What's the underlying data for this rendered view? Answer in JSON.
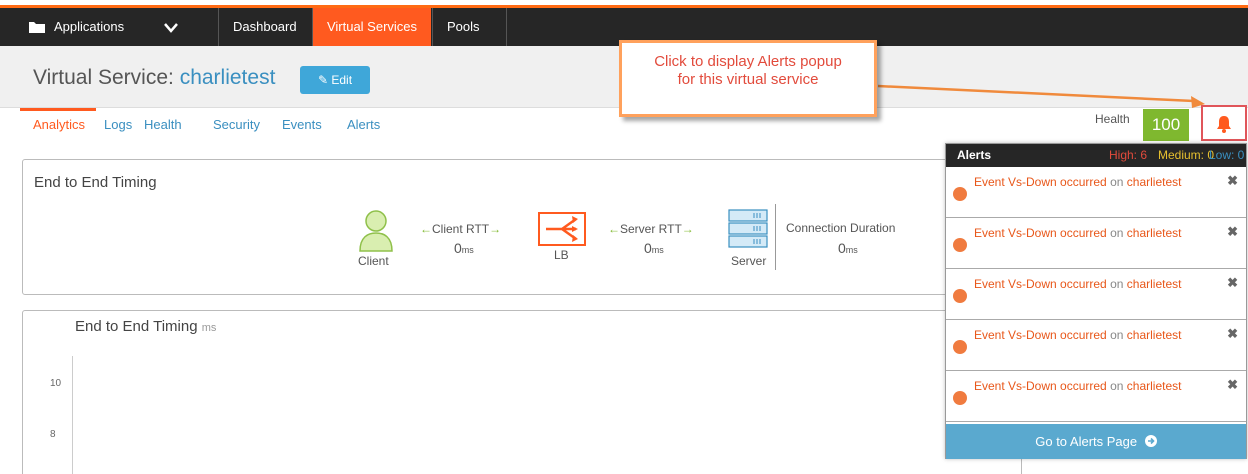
{
  "nav": {
    "applications_label": "Applications",
    "items": [
      "Dashboard",
      "Virtual Services",
      "Pools"
    ],
    "active_index": 1,
    "accent_color": "#ff5a1f"
  },
  "header": {
    "title_prefix": "Virtual Service:",
    "vs_name": "charlietest",
    "edit_label": "Edit"
  },
  "tabs": [
    "Analytics",
    "Logs",
    "Health",
    "Security",
    "Events",
    "Alerts"
  ],
  "health": {
    "label": "Health",
    "score": "100",
    "color": "#7fb82f"
  },
  "callout": {
    "line1": "Click to display Alerts popup",
    "line2": "for this virtual service"
  },
  "timing_panel": {
    "title": "End to End Timing",
    "client_label": "Client",
    "lb_label": "LB",
    "server_label": "Server",
    "client_rtt_label": "Client RTT",
    "server_rtt_label": "Server RTT",
    "connection_duration_label": "Connection Duration",
    "client_rtt_value": "0",
    "server_rtt_value": "0",
    "connection_duration_value": "0",
    "unit": "ms"
  },
  "chart_panel": {
    "title": "End to End Timing",
    "unit": "ms",
    "y_ticks": [
      "10",
      "8"
    ]
  },
  "alerts_popup": {
    "title": "Alerts",
    "high": "High: 6",
    "medium": "Medium: 0",
    "low": "Low: 0",
    "items": [
      {
        "event": "Event Vs-Down occurred",
        "on": "on",
        "object": "charlietest"
      },
      {
        "event": "Event Vs-Down occurred",
        "on": "on",
        "object": "charlietest"
      },
      {
        "event": "Event Vs-Down occurred",
        "on": "on",
        "object": "charlietest"
      },
      {
        "event": "Event Vs-Down occurred",
        "on": "on",
        "object": "charlietest"
      },
      {
        "event": "Event Vs-Down occurred",
        "on": "on",
        "object": "charlietest"
      }
    ],
    "close_glyph": "✖",
    "footer_label": "Go to Alerts Page"
  }
}
